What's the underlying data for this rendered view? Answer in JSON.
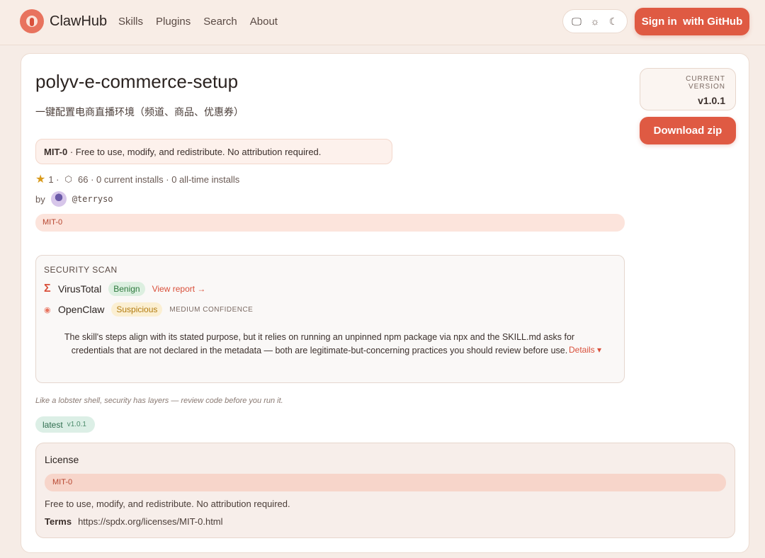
{
  "header": {
    "brand": "ClawHub",
    "nav": [
      "Skills",
      "Plugins",
      "Search",
      "About"
    ],
    "theme_icons": [
      "monitor-icon",
      "sun-icon",
      "moon-icon"
    ],
    "signin_label": "Sign in  with GitHub"
  },
  "skill": {
    "title": "polyv-e-commerce-setup",
    "subtitle": "一键配置电商直播环境（频道、商品、优惠券）",
    "license_pill": {
      "code": "MIT-0",
      "text": " · Free to use, modify, and redistribute. No attribution required."
    },
    "stats": {
      "stars": "1 ·",
      "installs": "66 · 0 current installs · 0 all-time installs"
    },
    "by_label": "by",
    "author": "@terryso",
    "tag": "MIT-0"
  },
  "sidebar": {
    "version_label": "CURRENT VERSION",
    "version": "v1.0.1",
    "download_label": "Download zip"
  },
  "security": {
    "title": "SECURITY SCAN",
    "virustotal": {
      "name": "VirusTotal",
      "status": "Benign",
      "link": "View report →"
    },
    "openclaw": {
      "name": "OpenClaw",
      "status": "Suspicious",
      "confidence": "MEDIUM CONFIDENCE"
    },
    "description": "The skill's steps align with its stated purpose, but it relies on running an unpinned npm package via npx and the SKILL.md asks for credentials that are not declared in the metadata — both are legitimate-but-concerning practices you should review before use.",
    "details_label": "Details ▾"
  },
  "tagline": "Like a lobster shell, security has layers — review code before you run it.",
  "latest_badge": {
    "label": "latest",
    "version": "v1.0.1"
  },
  "license_panel": {
    "title": "License",
    "code": "MIT-0",
    "text": "Free to use, modify, and redistribute. No attribution required.",
    "terms_label": "Terms",
    "terms_url": "https://spdx.org/licenses/MIT-0.html"
  },
  "colors": {
    "accent": "#df5a43",
    "background": "#f6ece6",
    "benign": "#2f7a3e",
    "suspicious": "#b27b0f"
  }
}
